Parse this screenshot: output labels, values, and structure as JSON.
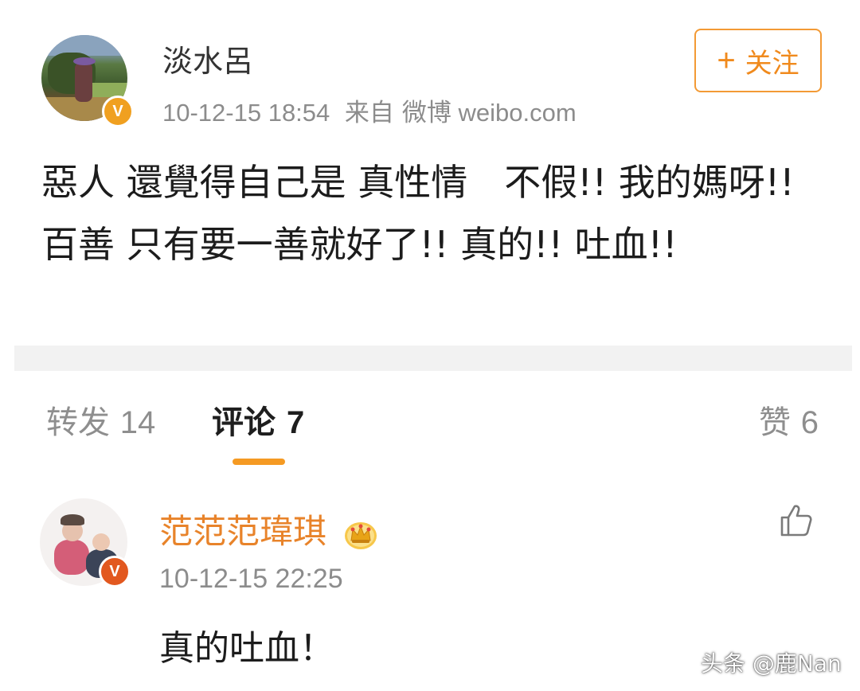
{
  "post": {
    "author": "淡水呂",
    "date": "10-12-15 18:54",
    "source_prefix": "来自",
    "source": "微博 weibo.com",
    "verified_badge": "V",
    "follow_button": {
      "icon": "+",
      "label": "关注"
    },
    "text": "惡人 還覺得自己是 真性情　不假!! 我的媽呀!!  百善  只有要一善就好了!! 真的!! 吐血!!"
  },
  "tabs": [
    {
      "label": "转发",
      "count": "14"
    },
    {
      "label": "评论",
      "count": "7",
      "active": true
    },
    {
      "label": "赞",
      "count": "6"
    }
  ],
  "comment": {
    "author": "范范范瑋琪",
    "verified_badge": "V",
    "time": "10-12-15 22:25",
    "text": "真的吐血！"
  },
  "watermark": "头条 @鹿Nan",
  "colors": {
    "accent_orange": "#f08a1d",
    "badge_orange": "#f0a020",
    "badge_red": "#e2581f",
    "meta_gray": "#8c8c8c",
    "divider_gray": "#f2f2f2"
  },
  "icons": {
    "follow": "plus-icon",
    "verified": "verified-v-icon",
    "vip": "crown-icon",
    "like": "thumbs-up-icon"
  }
}
